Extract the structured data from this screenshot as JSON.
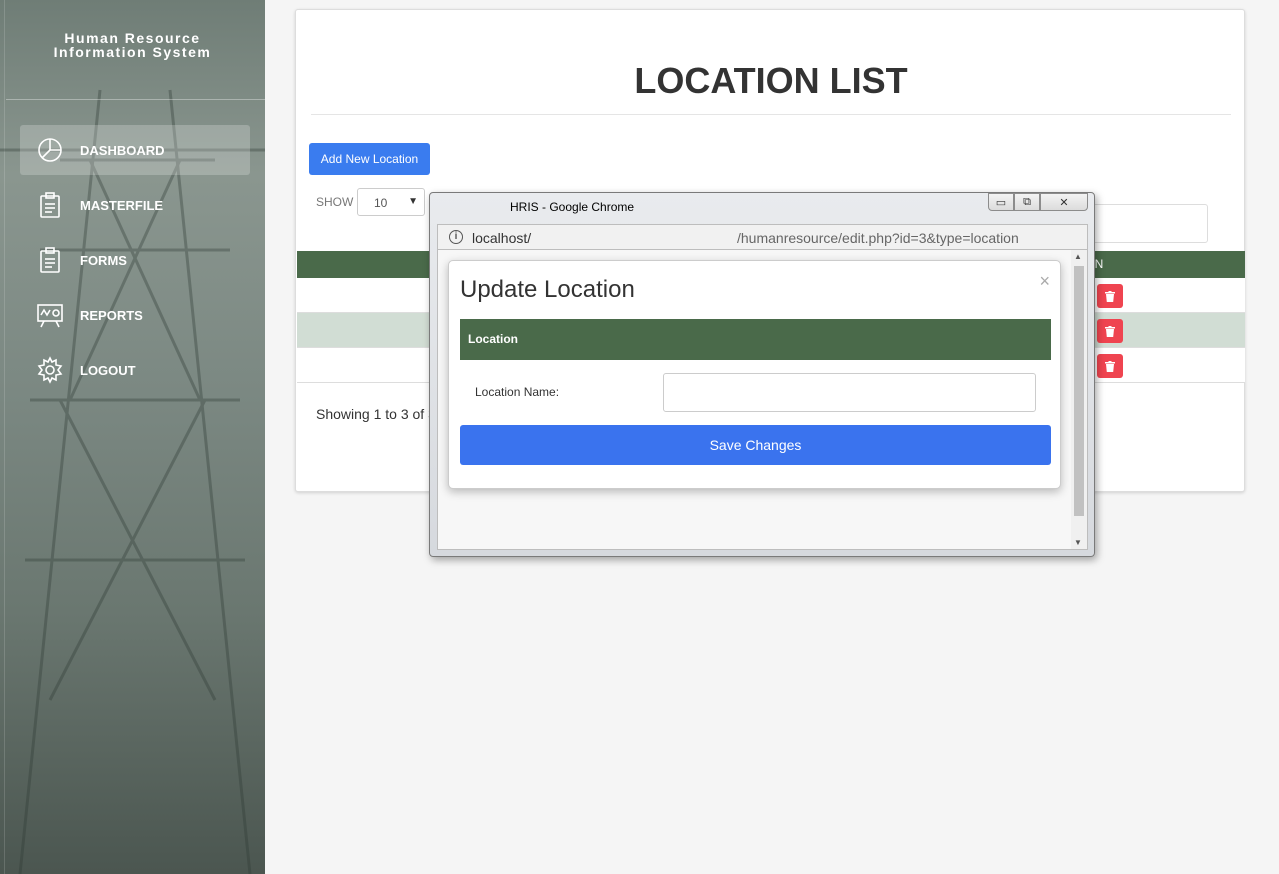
{
  "sidebar": {
    "brand_line1": "Human Resource",
    "brand_line2": "Information System",
    "items": [
      {
        "label": "DASHBOARD",
        "icon": "pie-chart-icon",
        "active": true
      },
      {
        "label": "MASTERFILE",
        "icon": "clipboard-icon"
      },
      {
        "label": "FORMS",
        "icon": "clipboard-icon"
      },
      {
        "label": "REPORTS",
        "icon": "presentation-icon"
      },
      {
        "label": "LOGOUT",
        "icon": "gear-icon"
      }
    ]
  },
  "main": {
    "title": "LOCATION LIST",
    "add_button": "Add New Location",
    "show_label": "SHOW",
    "show_value": "10",
    "table_header_action": "ION",
    "showing_text": "Showing 1 to 3 of 3"
  },
  "popup": {
    "window_title": "HRIS - Google Chrome",
    "url_host": "localhost/",
    "url_path": "/humanresource/edit.php?id=3&type=location",
    "modal_title": "Update Location",
    "close_symbol": "×",
    "section_title": "Location",
    "field_label": "Location Name:",
    "field_value": "",
    "save_button": "Save Changes"
  },
  "colors": {
    "primary_blue": "#3a7cef",
    "table_header_green": "#4a6a4a",
    "delete_red": "#ef4450",
    "alt_row": "#d1ddd4"
  }
}
